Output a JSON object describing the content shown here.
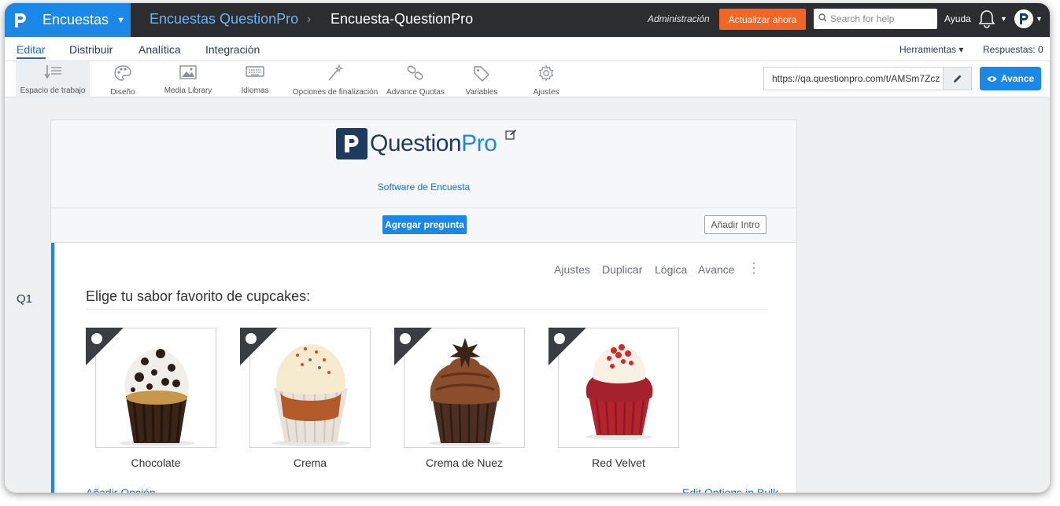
{
  "topbar": {
    "app_name": "Encuestas",
    "breadcrumb_parent": "Encuestas QuestionPro",
    "breadcrumb_current": "Encuesta-QuestionPro",
    "admin_label": "Administración",
    "upgrade_label": "Actualizar ahora",
    "search_placeholder": "Search for help",
    "help_label": "Ayuda"
  },
  "nav": {
    "tabs": [
      {
        "label": "Editar",
        "active": true
      },
      {
        "label": "Distribuir"
      },
      {
        "label": "Analítica"
      },
      {
        "label": "Integración"
      }
    ],
    "tools_label": "Herramientas",
    "responses_label": "Respuestas: 0"
  },
  "toolbar": {
    "tools": [
      {
        "label": "Espacio de trabajo",
        "icon": "workspace-icon"
      },
      {
        "label": "Diseño",
        "icon": "palette-icon"
      },
      {
        "label": "Media Library",
        "icon": "image-icon"
      },
      {
        "label": "Idiomas",
        "icon": "keyboard-icon"
      },
      {
        "label": "Opciones de finalización",
        "icon": "wand-icon"
      },
      {
        "label": "Advance Quotas",
        "icon": "link-icon"
      },
      {
        "label": "Variables",
        "icon": "tag-icon"
      },
      {
        "label": "Ajustes",
        "icon": "gear-icon"
      }
    ],
    "url": "https://qa.questionpro.com/t/AMSm7Zcz",
    "preview_label": "Avance"
  },
  "survey": {
    "logo_question": "Question",
    "logo_pro": "Pro",
    "subtitle": "Software de Encuesta",
    "add_question_label": "Agregar pregunta",
    "add_intro_label": "Añadir Intro"
  },
  "question": {
    "number": "Q1",
    "menu": [
      "Ajustes",
      "Duplicar",
      "Lógica",
      "Avance"
    ],
    "text": "Elige tu sabor favorito de cupcakes:",
    "options": [
      {
        "label": "Chocolate"
      },
      {
        "label": "Crema"
      },
      {
        "label": "Crema de Nuez"
      },
      {
        "label": "Red Velvet"
      }
    ],
    "add_option_label": "Añadir Opción",
    "bulk_label": "Edit Options in Bulk"
  }
}
